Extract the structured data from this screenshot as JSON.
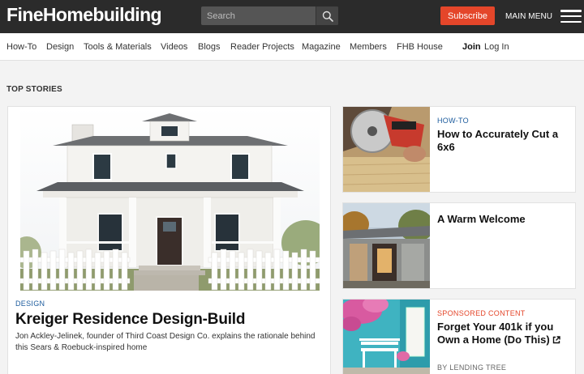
{
  "header": {
    "logo": "FineHomebuilding",
    "search_placeholder": "Search",
    "subscribe_label": "Subscribe",
    "main_menu_label": "MAIN MENU"
  },
  "nav": {
    "items": [
      "How-To",
      "Design",
      "Tools & Materials",
      "Videos",
      "Blogs",
      "Reader Projects",
      "Magazine",
      "Members",
      "FHB House"
    ],
    "join_label": "Join",
    "login_label": "Log In"
  },
  "section_title": "TOP STORIES",
  "feature": {
    "tag": "DESIGN",
    "title": "Kreiger Residence Design-Build",
    "description": "Jon Ackley-Jelinek, founder of Third Coast Design Co. explains the rationale behind this Sears & Roebuck-inspired home"
  },
  "side_stories": [
    {
      "tag": "HOW-TO",
      "title": "How to Accurately Cut a 6x6"
    },
    {
      "title": "A Warm Welcome"
    },
    {
      "tag": "SPONSORED CONTENT",
      "title": "Forget Your 401k if you Own a Home (Do This)",
      "byline": "BY LENDING TREE"
    }
  ],
  "colors": {
    "topbar": "#2b2b2b",
    "accent": "#e4462a",
    "tag_blue": "#1a5a9c"
  }
}
